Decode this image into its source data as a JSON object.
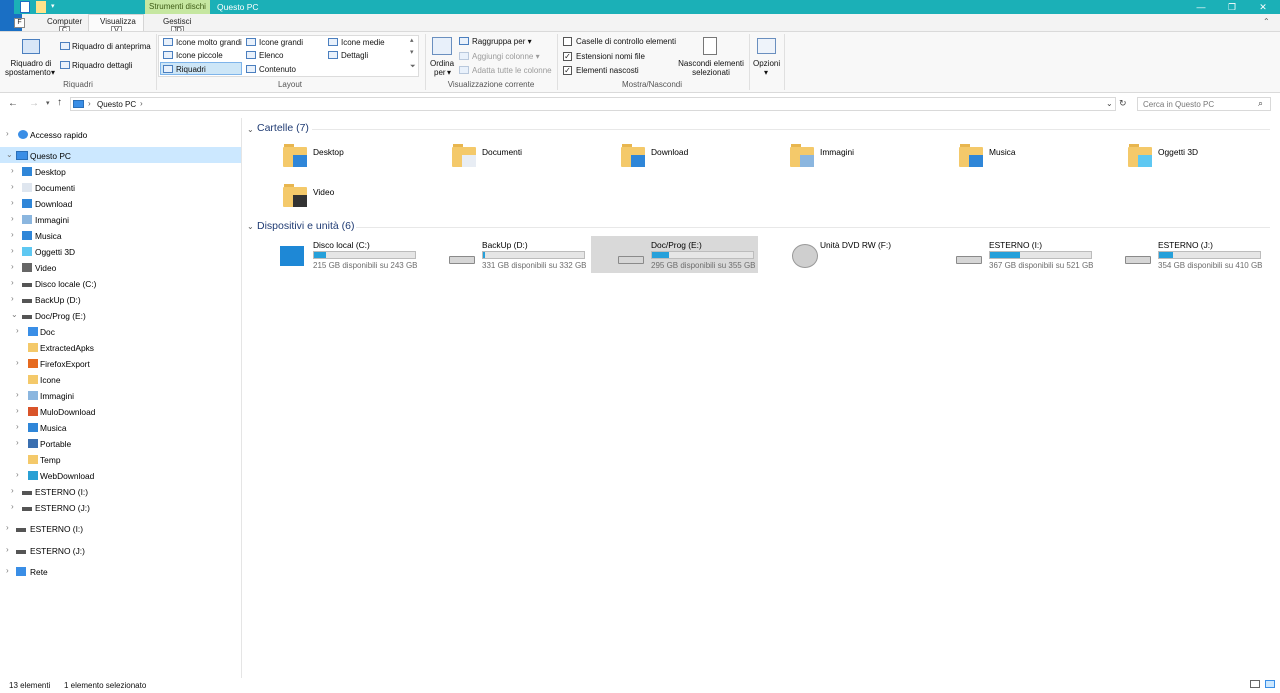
{
  "titlebar": {
    "context_tab": "Strumenti dischi",
    "title": "Questo PC",
    "quick_access": [
      "F",
      "1",
      "2",
      "3"
    ]
  },
  "ribbon": {
    "tabs": {
      "computer": "Computer",
      "visualizza": "Visualizza",
      "gestisci": "Gestisci"
    },
    "keytips": {
      "file": "F",
      "computer": "C",
      "visualizza": "V",
      "gestisci": "JD"
    },
    "riquadri": {
      "spostamento": "Riquadro di spostamento",
      "spostamento_line1": "Riquadro di",
      "spostamento_line2": "spostamento",
      "anteprima": "Riquadro di anteprima",
      "dettagli": "Riquadro dettagli",
      "group": "Riquadri"
    },
    "layout": {
      "molto_grandi": "Icone molto grandi",
      "grandi": "Icone grandi",
      "medie": "Icone medie",
      "piccole": "Icone piccole",
      "elenco": "Elenco",
      "dettagli": "Dettagli",
      "riquadri": "Riquadri",
      "contenuto": "Contenuto",
      "group": "Layout"
    },
    "visualizzazione": {
      "ordina_line1": "Ordina",
      "ordina_line2": "per",
      "raggruppa": "Raggruppa per",
      "aggiungi": "Aggiungi colonne",
      "adatta": "Adatta tutte le colonne",
      "group": "Visualizzazione corrente"
    },
    "mostra": {
      "caselle": "Caselle di controllo elementi",
      "estensioni": "Estensioni nomi file",
      "nascosti": "Elementi nascosti",
      "nascondi_line1": "Nascondi elementi",
      "nascondi_line2": "selezionati",
      "group": "Mostra/Nascondi",
      "caselle_checked": false,
      "estensioni_checked": true,
      "nascosti_checked": true
    },
    "opzioni": "Opzioni"
  },
  "address": {
    "path": "Questo PC",
    "search_placeholder": "Cerca in Questo PC"
  },
  "sidebar": {
    "accesso_rapido": "Accesso rapido",
    "questo_pc": "Questo PC",
    "pc_children": [
      "Desktop",
      "Documenti",
      "Download",
      "Immagini",
      "Musica",
      "Oggetti 3D",
      "Video",
      "Disco locale (C:)",
      "BackUp (D:)",
      "Doc/Prog (E:)"
    ],
    "e_children": [
      "Doc",
      "ExtractedApks",
      "FirefoxExport",
      "Icone",
      "Immagini",
      "MuloDownload",
      "Musica",
      "Portable",
      "Temp",
      "WebDownload"
    ],
    "pc_tail": [
      "ESTERNO (I:)",
      "ESTERNO (J:)"
    ],
    "root_tail": [
      "ESTERNO (I:)",
      "ESTERNO (J:)",
      "Rete"
    ]
  },
  "content": {
    "folders_header": "Cartelle (7)",
    "folders": [
      "Desktop",
      "Documenti",
      "Download",
      "Immagini",
      "Musica",
      "Oggetti 3D",
      "Video"
    ],
    "drives_header": "Dispositivi e unità (6)",
    "drives": [
      {
        "name": "Disco local (C:)",
        "free": "215 GB disponibili su 243 GB",
        "used": 0.12
      },
      {
        "name": "BackUp (D:)",
        "free": "331 GB disponibili su 332 GB",
        "used": 0.005
      },
      {
        "name": "Doc/Prog (E:)",
        "free": "295 GB disponibili su 355 GB",
        "used": 0.17
      },
      {
        "name": "Unità DVD RW (F:)",
        "free": "",
        "used": 0
      },
      {
        "name": "ESTERNO (I:)",
        "free": "367 GB disponibili su 521 GB",
        "used": 0.3
      },
      {
        "name": "ESTERNO (J:)",
        "free": "354 GB disponibili su 410 GB",
        "used": 0.14
      }
    ]
  },
  "status": {
    "count": "13 elementi",
    "selected": "1 elemento selezionato"
  },
  "colors": {
    "accent": "#1bb0b7",
    "selection": "#cce8ff",
    "bar": "#26a0da"
  }
}
